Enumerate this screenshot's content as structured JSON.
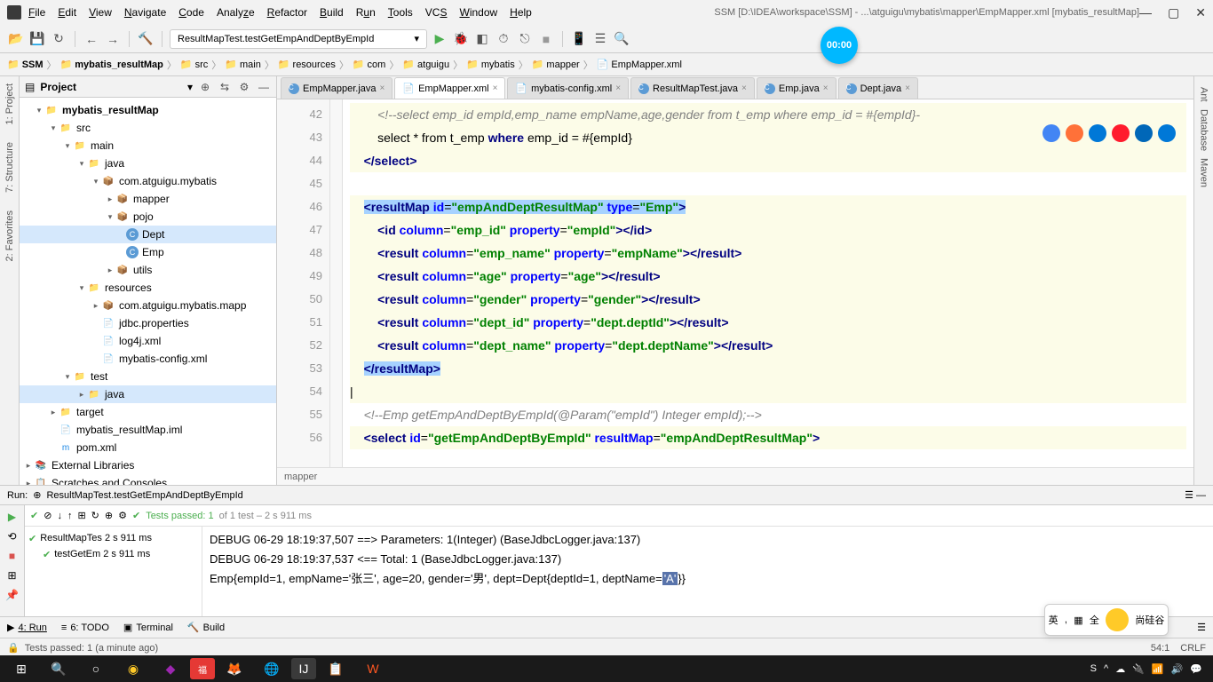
{
  "titlebar": {
    "path": "SSM [D:\\IDEA\\workspace\\SSM] - ...\\atguigu\\mybatis\\mapper\\EmpMapper.xml [mybatis_resultMap]"
  },
  "menu": [
    "File",
    "Edit",
    "View",
    "Navigate",
    "Code",
    "Analyze",
    "Refactor",
    "Build",
    "Run",
    "Tools",
    "VCS",
    "Window",
    "Help"
  ],
  "run_config": "ResultMapTest.testGetEmpAndDeptByEmpId",
  "timer": "00:00",
  "breadcrumb": [
    "SSM",
    "mybatis_resultMap",
    "src",
    "main",
    "resources",
    "com",
    "atguigu",
    "mybatis",
    "mapper",
    "EmpMapper.xml"
  ],
  "project_title": "Project",
  "tree": {
    "root": "mybatis_resultMap",
    "src": "src",
    "main": "main",
    "java": "java",
    "pkg": "com.atguigu.mybatis",
    "mapper": "mapper",
    "pojo": "pojo",
    "dept": "Dept",
    "emp": "Emp",
    "utils": "utils",
    "resources": "resources",
    "res_pkg": "com.atguigu.mybatis.mapp",
    "jdbc": "jdbc.properties",
    "log4j": "log4j.xml",
    "mybatis_cfg": "mybatis-config.xml",
    "test": "test",
    "test_java": "java",
    "target": "target",
    "iml": "mybatis_resultMap.iml",
    "pom": "pom.xml",
    "ext_lib": "External Libraries",
    "scratches": "Scratches and Consoles"
  },
  "tabs": [
    {
      "name": "EmpMapper.java",
      "icon": "class"
    },
    {
      "name": "EmpMapper.xml",
      "icon": "xml",
      "active": true
    },
    {
      "name": "mybatis-config.xml",
      "icon": "xml"
    },
    {
      "name": "ResultMapTest.java",
      "icon": "class"
    },
    {
      "name": "Emp.java",
      "icon": "class"
    },
    {
      "name": "Dept.java",
      "icon": "class"
    }
  ],
  "line_numbers": [
    "42",
    "43",
    "44",
    "45",
    "46",
    "47",
    "48",
    "49",
    "50",
    "51",
    "52",
    "53",
    "54",
    "55",
    "56"
  ],
  "code": {
    "l42_comment": "<!--select emp_id empId,emp_name empName,age,gender from t_emp where emp_id = #{empId}-",
    "l43": "select * from t_emp where emp_id = #{empId}",
    "l44": "</select>",
    "l46_open": "<resultMap id=\"empAndDeptResultMap\" type=\"Emp\">",
    "l47": "<id column=\"emp_id\" property=\"empId\"></id>",
    "l48": "<result column=\"emp_name\" property=\"empName\"></result>",
    "l49": "<result column=\"age\" property=\"age\"></result>",
    "l50": "<result column=\"gender\" property=\"gender\"></result>",
    "l51": "<result column=\"dept_id\" property=\"dept.deptId\"></result>",
    "l52": "<result column=\"dept_name\" property=\"dept.deptName\"></result>",
    "l53": "</resultMap>",
    "l55_comment": "<!--Emp getEmpAndDeptByEmpId(@Param(\"empId\") Integer empId);-->",
    "l56": "<select id=\"getEmpAndDeptByEmpId\" resultMap=\"empAndDeptResultMap\">"
  },
  "crumb_bottom": "mapper",
  "run": {
    "title": "Run:",
    "config": "ResultMapTest.testGetEmpAndDeptByEmpId",
    "tests_passed": "Tests passed: 1",
    "tests_total": "of 1 test – 2 s 911 ms",
    "tree_root": "ResultMapTes 2 s 911 ms",
    "tree_test": "testGetEm 2 s 911 ms",
    "console_l1": "DEBUG 06-29 18:19:37,507 ==> Parameters: 1(Integer)  (BaseJdbcLogger.java:137)",
    "console_l2": "DEBUG 06-29 18:19:37,537 <==      Total: 1  (BaseJdbcLogger.java:137)",
    "console_l3_pre": "Emp{empId=1, empName='张三', age=20, gender='男', dept=Dept{deptId=1, deptName=",
    "console_l3_hl": "'A'",
    "console_l3_post": "}}"
  },
  "bottom_tabs": {
    "run": "4: Run",
    "todo": "6: TODO",
    "terminal": "Terminal",
    "build": "Build"
  },
  "status": {
    "left": "Tests passed: 1 (a minute ago)",
    "pos": "54:1",
    "enc": "CRLF"
  },
  "side_tabs": {
    "project": "1: Project",
    "structure": "7: Structure",
    "favorites": "2: Favorites",
    "ant": "Ant",
    "database": "Database",
    "maven": "Maven"
  },
  "float": {
    "t1": "英",
    "t2": "全",
    "t3": "尚硅谷"
  }
}
